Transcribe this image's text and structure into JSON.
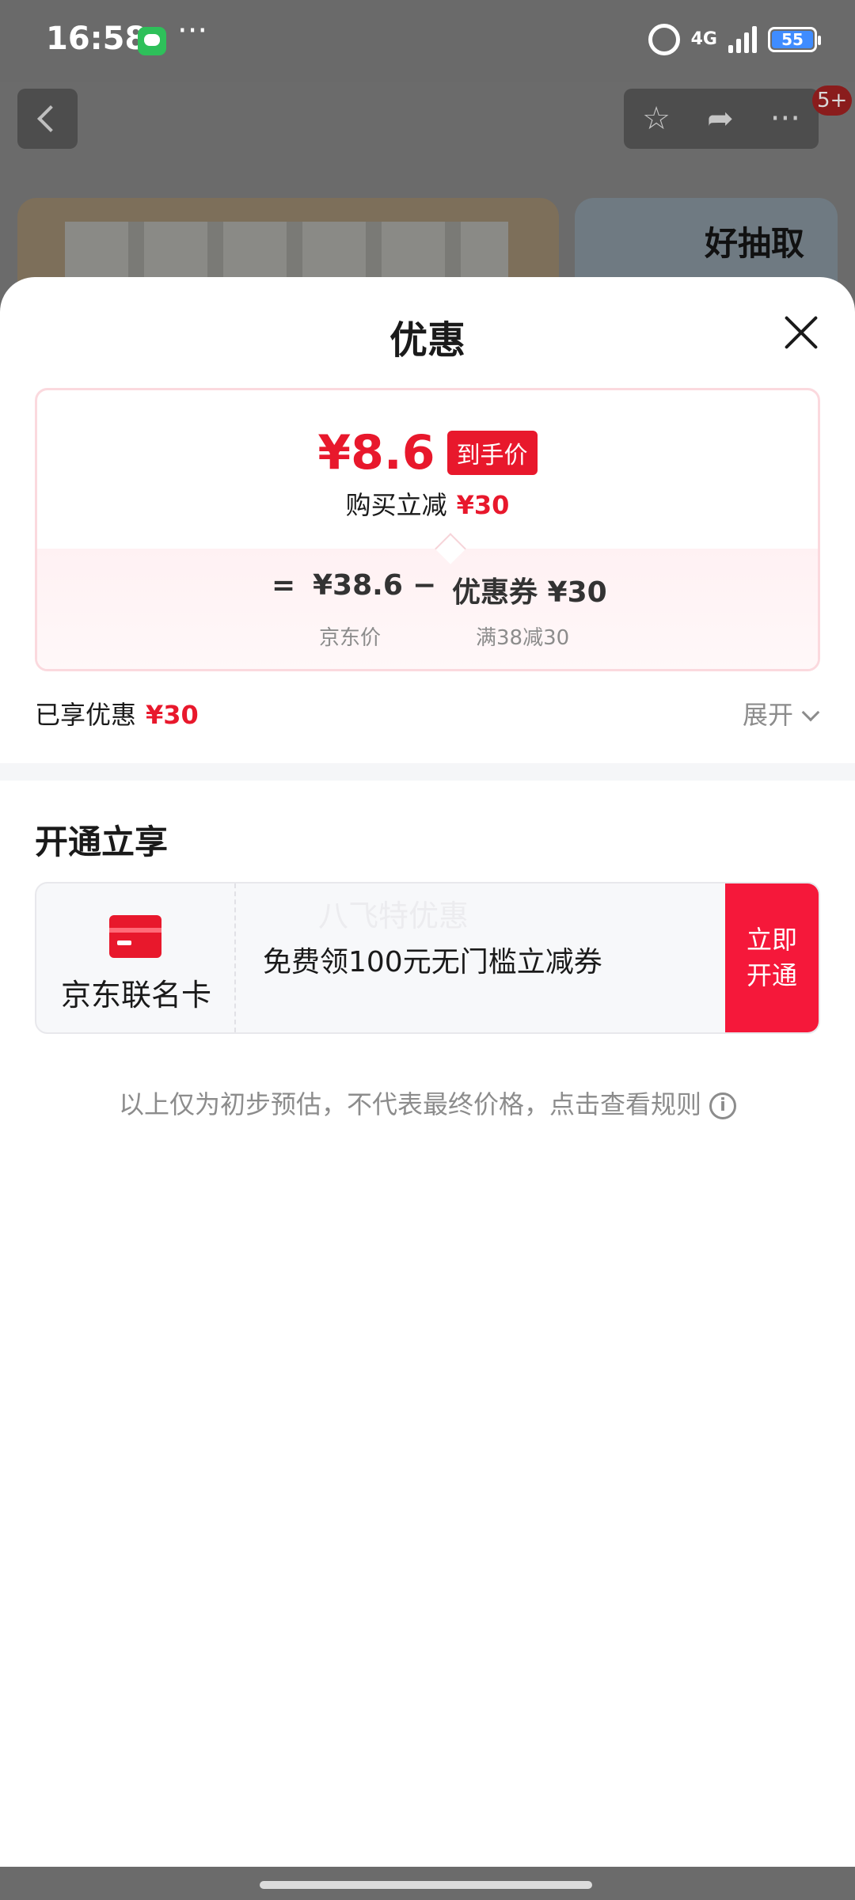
{
  "status_bar": {
    "time": "16:58",
    "network": "4G",
    "battery": "55"
  },
  "background_page": {
    "badge": "5+",
    "banner_text": "好抽取"
  },
  "sheet": {
    "title": "优惠",
    "price_card": {
      "final_price": "¥8.6",
      "final_tag": "到手价",
      "reduce_label": "购买立减",
      "reduce_amount": "¥30",
      "equals": "=",
      "jd_price": "¥38.6",
      "minus": "−",
      "coupon": "优惠券 ¥30",
      "jd_price_label": "京东价",
      "coupon_rule": "满38减30"
    },
    "enjoyed": {
      "label": "已享优惠",
      "amount": "¥30",
      "expand": "展开"
    },
    "open_section": {
      "title": "开通立享",
      "card_name": "京东联名卡",
      "card_watermark": "八飞特优惠",
      "card_desc": "免费领100元无门槛立减券",
      "cta": "立即开通"
    },
    "disclaimer": "以上仅为初步预估，不代表最终价格，点击查看规则"
  },
  "colors": {
    "accent_red": "#e8182c",
    "cta_red": "#f5183a"
  }
}
